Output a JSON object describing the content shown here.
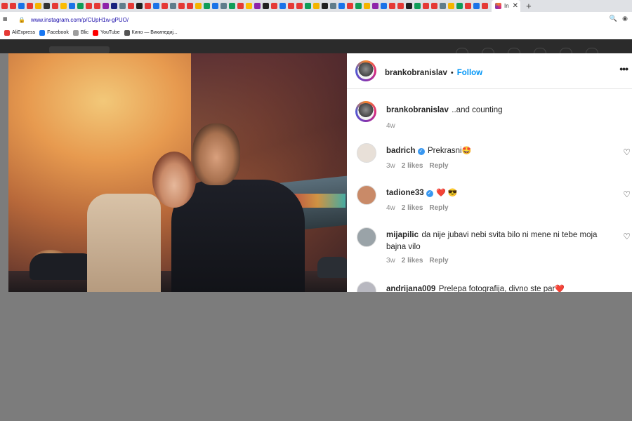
{
  "browser": {
    "url": "www.instagram.com/p/CUpH1w-gPUO/",
    "active_tab_title": "In",
    "close_symbol": "✕",
    "new_tab_symbol": "+",
    "tab_favicon_colors": [
      "#e53935",
      "#e53935",
      "#1a73e8",
      "#e53935",
      "#f4b400",
      "#333333",
      "#e53935",
      "#fbbc05",
      "#1a73e8",
      "#0f9d58",
      "#e53935",
      "#e53935",
      "#8e24aa",
      "#1a237e",
      "#607d8b",
      "#e53935",
      "#212121",
      "#e53935",
      "#1a73e8",
      "#e53935",
      "#607d8b",
      "#e53935",
      "#e53935",
      "#f4b400",
      "#0f9d58",
      "#1a73e8",
      "#607d8b",
      "#0f9d58",
      "#e53935",
      "#fbbc05",
      "#8e24aa",
      "#212121",
      "#e53935",
      "#1a73e8",
      "#e53935",
      "#e53935",
      "#0f9d58",
      "#f4b400",
      "#212121",
      "#607d8b",
      "#1a73e8",
      "#e53935",
      "#0f9d58",
      "#f4b400",
      "#8e24aa",
      "#1a73e8",
      "#e53935",
      "#e53935",
      "#212121",
      "#0f9d58",
      "#e53935",
      "#e53935",
      "#607d8b",
      "#f4b400",
      "#0f9d58",
      "#e53935",
      "#1a73e8",
      "#e53935"
    ],
    "bookmarks": [
      {
        "label": "AliExpress",
        "color": "#e53935"
      },
      {
        "label": "Facebook",
        "color": "#1877f2"
      },
      {
        "label": "Blic",
        "color": "#9e9e9e"
      },
      {
        "label": "YouTube",
        "color": "#ff0000"
      },
      {
        "label": "Кино — Википедиј...",
        "color": "#555555"
      }
    ]
  },
  "post": {
    "author": "brankobranislav",
    "follow_label": "Follow",
    "more_symbol": "•••",
    "caption": {
      "username": "brankobranislav",
      "text": "..and counting",
      "time": "4w"
    },
    "comments": [
      {
        "username": "badrich",
        "verified": true,
        "text": "Prekrasni",
        "emoji": "🤩",
        "time": "3w",
        "likes": "2 likes",
        "reply": "Reply",
        "avatar_color": "#e8e0d8"
      },
      {
        "username": "tadione33",
        "verified": true,
        "text": "",
        "emoji": "❤️ 😎",
        "time": "4w",
        "likes": "2 likes",
        "reply": "Reply",
        "avatar_color": "#c98a68"
      },
      {
        "username": "mijapilic",
        "verified": false,
        "text": "da nije jubavi nebi svita bilo ni mene ni tebe moja bajna vilo",
        "emoji": "",
        "time": "3w",
        "likes": "2 likes",
        "reply": "Reply",
        "avatar_color": "#9aa3a8"
      },
      {
        "username": "andrijana009",
        "verified": false,
        "text": "Prelepa fotografija, divno ste par",
        "emoji": "❤️",
        "time": "",
        "likes": "",
        "reply": "",
        "avatar_color": "#b8b8c0"
      }
    ],
    "heart_symbol": "♡"
  },
  "colors": {
    "follow": "#0095f6",
    "verified": "#3897f0",
    "background_gray": "#7c7c7c"
  }
}
